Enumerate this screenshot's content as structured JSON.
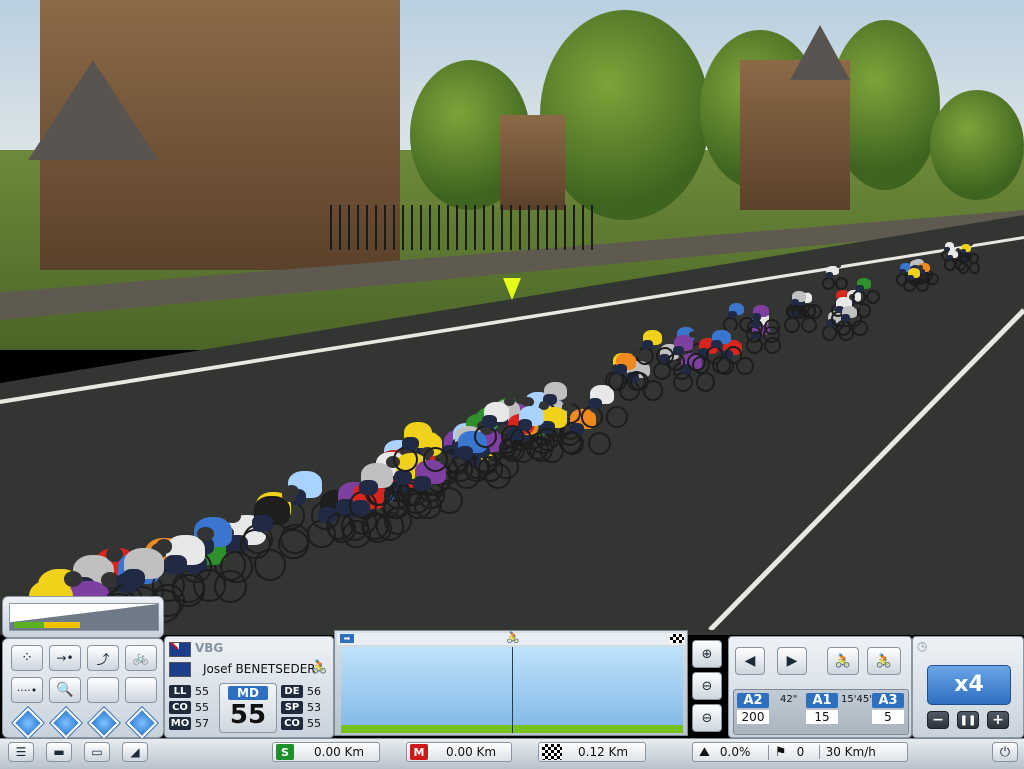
{
  "team": {
    "code": "VBG",
    "flag_icon": "australia-flag-icon"
  },
  "rider": {
    "name": "Josef BENETSEDER",
    "profile_icon": "rider-profile-icon"
  },
  "stats_left": [
    {
      "key": "LL",
      "value": "55"
    },
    {
      "key": "CO",
      "value": "55"
    },
    {
      "key": "MO",
      "value": "57"
    }
  ],
  "main_stat": {
    "key": "MD",
    "value": "55"
  },
  "stats_right": [
    {
      "key": "DE",
      "value": "56"
    },
    {
      "key": "SP",
      "value": "53"
    },
    {
      "key": "CO",
      "value": "55"
    }
  ],
  "gaps": [
    {
      "label": "A2",
      "time": "",
      "count": "200"
    },
    {
      "label": "A1",
      "time": "42\"",
      "count": "15"
    },
    {
      "label": "A3",
      "time": "15'45\"",
      "count": "5"
    }
  ],
  "speed_multiplier": "x4",
  "bottom": {
    "start": {
      "icon": "S",
      "value": "0.00 Km"
    },
    "mountain": {
      "icon": "M",
      "value": "0.00 Km"
    },
    "finish": {
      "value": "0.12 Km"
    },
    "slope": "0.0%",
    "flag_count": "0",
    "speed": "30 Km/h"
  },
  "colors": {
    "accent": "#2f6fc0",
    "effort_yellow": "#f2c200",
    "effort_green": "#5ab21e",
    "start_green": "#1e8f2a",
    "mountain_red": "#d01818"
  },
  "progress": {
    "effort_fraction": 0.25,
    "route_position_fraction": 0.5
  }
}
